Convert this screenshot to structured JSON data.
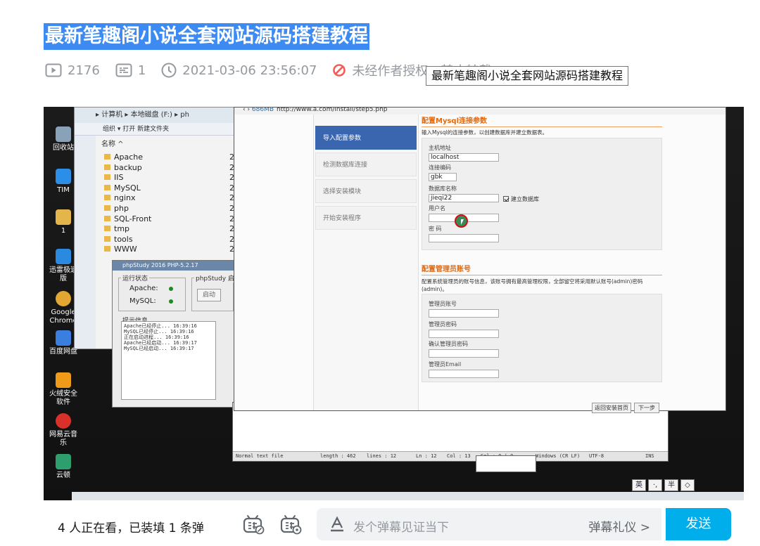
{
  "header": {
    "title": "最新笔趣阁小说全套网站源码搭建教程",
    "play_count": "2176",
    "danmaku_count": "1",
    "publish_time": "2021-03-06 23:56:07",
    "copyright": "未经作者授权，禁止转载",
    "tooltip": "最新笔趣阁小说全套网站源码搭建教程"
  },
  "video": {
    "desktop_icons": [
      "回收站",
      "TIM",
      "1",
      "迅雷极速版",
      "Google Chrome",
      "百度网盘",
      "火绒安全软件",
      "网易云音乐",
      "云顿"
    ],
    "explorer": {
      "breadcrumb": "▸ 计算机 ▸ 本地磁盘 (F:) ▸ ph",
      "toolbar": "组织 ▾   打开   新建文件夹",
      "column_header": "名称 ^",
      "folders": [
        "Apache",
        "backup",
        "IIS",
        "MySQL",
        "nginx",
        "php",
        "SQL-Front",
        "tmp",
        "tools",
        "WWW"
      ],
      "date_prefix": "20"
    },
    "phpstudy": {
      "title": "phpStudy 2016   PHP-5.2.17",
      "run_status": "运行状态",
      "apache": "Apache:",
      "mysql": "MySQL:",
      "start_label": "phpStudy 启停",
      "start_btn": "启动",
      "info_label": "提示信息",
      "log": [
        "Apache已经停止...    16:39:16",
        "MySQL已经停止...     16:39:16",
        "正在启动进程...      16:39:16",
        "Apache已经启动...    16:39:17",
        "MySQL已经启动...     16:39:17"
      ]
    },
    "notepad_status": {
      "type": "Normal text file",
      "length": "length : 462",
      "lines": "lines : 12",
      "ln": "Ln : 12",
      "col": "Col : 13",
      "sel": "Sel : 0 | 0",
      "eol": "Windows (CR LF)",
      "enc": "UTF-8",
      "ins": "INS"
    },
    "browser": {
      "size": "686MB",
      "url": "http://www.a.com/install/step5.php",
      "steps": [
        "导入配置参数",
        "检测数据库连接",
        "选择安装模块",
        "开始安装程序"
      ],
      "mysql_section": "配置Mysql连接参数",
      "mysql_desc": "输入Mysql的连接参数，以创建数据库并建立数据表。",
      "host_label": "主机地址",
      "host_value": "localhost",
      "charset_label": "连接编码",
      "charset_value": "gbk",
      "dbname_label": "数据库名称",
      "dbname_value": "jieqi22",
      "create_db": "建立数据库",
      "user_label": "用户名",
      "pass_label": "密  码",
      "admin_section": "配置管理员账号",
      "admin_desc1": "配置系统管理员的账号信息，该账号拥有最高管理权限，全部留空将采用默认账号(admin)密码",
      "admin_desc2": "(admin)。",
      "admin_user": "管理员账号",
      "admin_pass": "管理员密码",
      "admin_pass2": "确认管理员密码",
      "admin_email": "管理员Email",
      "back_btn": "返回安装首页",
      "next_btn": "下一步"
    },
    "ime": [
      "英",
      "·,",
      "半",
      "◇"
    ]
  },
  "danmaku": {
    "watching": "4 人正在看，已装填 1 条弹",
    "placeholder": "发个弹幕见证当下",
    "etiquette": "弹幕礼仪 >",
    "send": "发送"
  },
  "colors": {
    "accent": "#00aeec",
    "title_highlight": "#3d8bf2",
    "meta_gray": "#9499a0",
    "warning_red": "#f25d59"
  }
}
